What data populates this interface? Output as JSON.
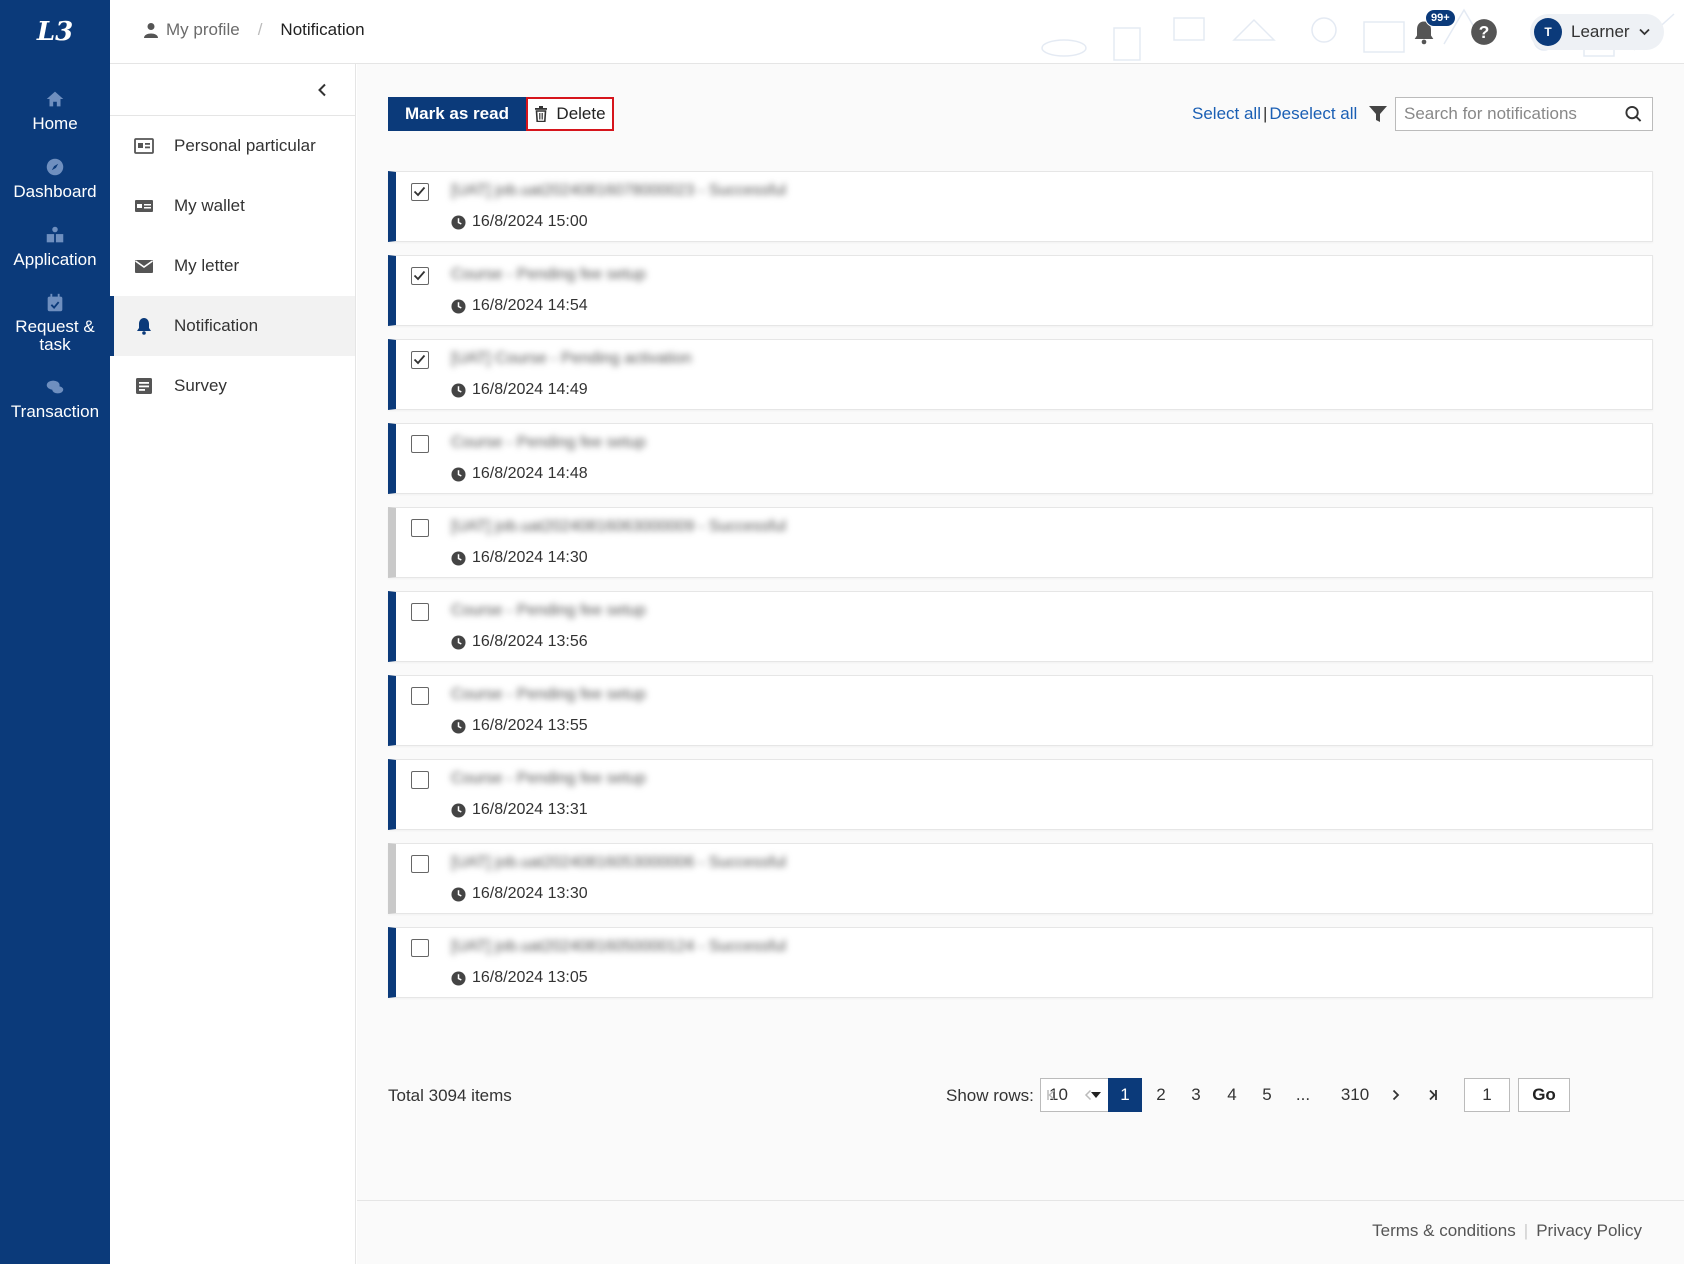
{
  "nav": {
    "logo": "L3",
    "items": [
      {
        "label": "Home",
        "icon": "home-icon"
      },
      {
        "label": "Dashboard",
        "icon": "compass-icon"
      },
      {
        "label": "Application",
        "icon": "application-icon"
      },
      {
        "label": "Request &\ntask",
        "icon": "calendar-check-icon"
      },
      {
        "label": "Transaction",
        "icon": "transaction-icon"
      }
    ]
  },
  "header": {
    "breadcrumb_profile": "My profile",
    "breadcrumb_sep": "/",
    "breadcrumb_current": "Notification",
    "bell_badge": "99+",
    "user_initial": "T",
    "user_name": "Learner"
  },
  "sidemenu": {
    "items": [
      {
        "label": "Personal particular",
        "icon": "id-card-icon"
      },
      {
        "label": "My wallet",
        "icon": "wallet-icon"
      },
      {
        "label": "My letter",
        "icon": "envelope-icon"
      },
      {
        "label": "Notification",
        "icon": "bell-icon",
        "active": true
      },
      {
        "label": "Survey",
        "icon": "survey-icon"
      }
    ]
  },
  "toolbar": {
    "mark_as_read": "Mark as read",
    "delete": "Delete",
    "select_all": "Select all",
    "deselect_all": "Deselect all",
    "search_placeholder": "Search for notifications"
  },
  "notifications": [
    {
      "title": "[UAT] job.uat20240816078000023 - Successful",
      "time": "16/8/2024 15:00",
      "checked": true,
      "unread": true
    },
    {
      "title": "Course - Pending fee setup",
      "time": "16/8/2024 14:54",
      "checked": true,
      "unread": true
    },
    {
      "title": "[UAT] Course - Pending activation",
      "time": "16/8/2024 14:49",
      "checked": true,
      "unread": true
    },
    {
      "title": "Course - Pending fee setup",
      "time": "16/8/2024 14:48",
      "checked": false,
      "unread": true
    },
    {
      "title": "[UAT] job.uat20240816063000009 - Successful",
      "time": "16/8/2024 14:30",
      "checked": false,
      "unread": false
    },
    {
      "title": "Course - Pending fee setup",
      "time": "16/8/2024 13:56",
      "checked": false,
      "unread": true
    },
    {
      "title": "Course - Pending fee setup",
      "time": "16/8/2024 13:55",
      "checked": false,
      "unread": true
    },
    {
      "title": "Course - Pending fee setup",
      "time": "16/8/2024 13:31",
      "checked": false,
      "unread": true
    },
    {
      "title": "[UAT] job.uat20240816053000006 - Successful",
      "time": "16/8/2024 13:30",
      "checked": false,
      "unread": false
    },
    {
      "title": "[UAT] job.uat20240816050000124 - Successful",
      "time": "16/8/2024 13:05",
      "checked": false,
      "unread": true
    }
  ],
  "pager": {
    "total": "Total 3094 items",
    "show_rows_label": "Show rows:",
    "rows_value": "10",
    "pages": [
      "1",
      "2",
      "3",
      "4",
      "5",
      "...",
      "310"
    ],
    "current_page": "1",
    "go_page_value": "1",
    "go_label": "Go"
  },
  "footer": {
    "terms": "Terms & conditions",
    "privacy": "Privacy Policy"
  },
  "colors": {
    "primary": "#0b3a7a",
    "delete_highlight": "#d6151c",
    "link": "#1a5fb4"
  }
}
